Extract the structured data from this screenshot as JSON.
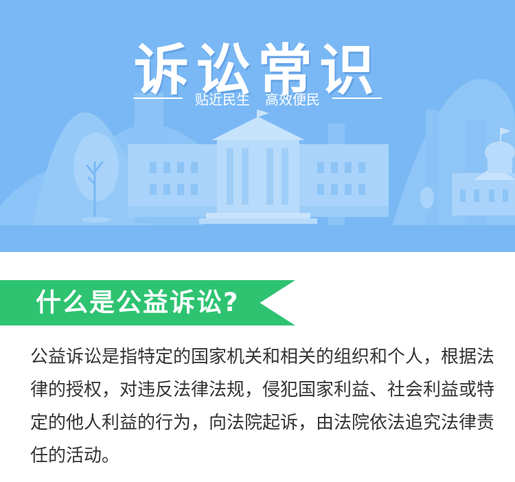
{
  "banner": {
    "title": "诉讼常识",
    "subtitle_left": "贴近民生",
    "subtitle_right": "高效便民",
    "background_color": "#7ab8f5"
  },
  "section": {
    "heading": "什么是公益诉讼?",
    "heading_color": "#2ec371"
  },
  "content": {
    "paragraph": "公益诉讼是指特定的国家机关和相关的组织和个人，根据法律的授权，对违反法律法规，侵犯国家利益、社会利益或特定的他人利益的行为，向法院起诉，由法院依法追究法律责任的活动。"
  }
}
